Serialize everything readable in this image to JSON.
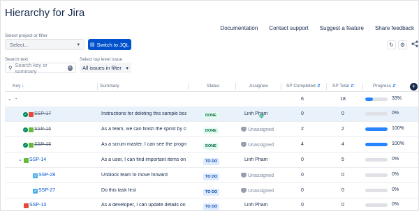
{
  "app": {
    "title": "Hierarchy for Jira",
    "links": [
      "Documentation",
      "Contact support",
      "Suggest a feature",
      "Share feedback"
    ]
  },
  "filters": {
    "project_label": "Select project or filter",
    "project_value": "Select...",
    "jql_button": "Switch to JQL",
    "search_label": "Search text",
    "search_placeholder": "Search key or summary",
    "level_label": "Select top level issue",
    "level_value": "All issues in filter"
  },
  "icons": {
    "refresh": "refresh-icon",
    "settings": "gear-icon",
    "share": "share-icon"
  },
  "table": {
    "headers": {
      "key": "Key",
      "summary": "Summary",
      "status": "Status",
      "assignee": "Assignee",
      "sp_completed": "SP Completed",
      "sp_total": "SP Total",
      "progress": "Progress"
    },
    "rows": [
      {
        "key": "-",
        "summary": "",
        "status": "",
        "assignee": "",
        "sp_completed": "6",
        "sp_total": "18",
        "progress": 33,
        "progress_label": "33%"
      },
      {
        "key": "SSP-17",
        "summary": "Instructions for deleting this sample board",
        "status": "DONE",
        "assignee": "Linh Pham",
        "sp_completed": "0",
        "sp_total": "0",
        "progress": 0,
        "progress_label": "0%"
      },
      {
        "key": "SSP-16",
        "summary": "As a team, we can finish the sprint by clicking",
        "status": "DONE",
        "assignee": "Unassigned",
        "sp_completed": "2",
        "sp_total": "2",
        "progress": 100,
        "progress_label": "100%"
      },
      {
        "key": "SSP-15",
        "summary": "As a scrum master, I can see the progress",
        "status": "DONE",
        "assignee": "Unassigned",
        "sp_completed": "4",
        "sp_total": "4",
        "progress": 100,
        "progress_label": "100%"
      },
      {
        "key": "SSP-14",
        "summary": "As a user, I can find important items on the",
        "status": "TO DO",
        "assignee": "Linh Pham",
        "sp_completed": "0",
        "sp_total": "5",
        "progress": 0,
        "progress_label": "0%"
      },
      {
        "key": "SSP-28",
        "summary": "Unblock team to move forward",
        "status": "TO DO",
        "assignee": "Unassigned",
        "sp_completed": "0",
        "sp_total": "0",
        "progress": 0,
        "progress_label": "0%"
      },
      {
        "key": "SSP-27",
        "summary": "Do this task first",
        "status": "TO DO",
        "assignee": "Unassigned",
        "sp_completed": "0",
        "sp_total": "0",
        "progress": 0,
        "progress_label": "0%"
      },
      {
        "key": "SSP-13",
        "summary": "As a developer, I can update details on an",
        "status": "TO DO",
        "assignee": "Linh Pham",
        "sp_completed": "0",
        "sp_total": "0",
        "progress": 0,
        "progress_label": "0%"
      }
    ]
  },
  "colors": {
    "primary": "#0052cc",
    "progress": "#2684ff",
    "done_bg": "#e3fcef",
    "todo_bg": "#deebff"
  }
}
